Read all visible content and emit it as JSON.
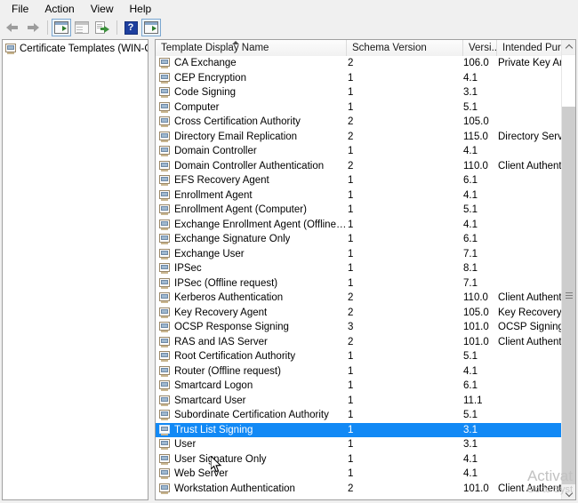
{
  "menu": {
    "items": [
      {
        "label": "File"
      },
      {
        "label": "Action"
      },
      {
        "label": "View"
      },
      {
        "label": "Help"
      }
    ]
  },
  "toolbar": {
    "back": {
      "name": "back-arrow-icon",
      "label": "Back"
    },
    "forward": {
      "name": "forward-arrow-icon",
      "label": "Forward"
    },
    "show_hide_tree": {
      "name": "show-hide-console-tree-icon",
      "label": "Show/Hide Console Tree"
    },
    "properties": {
      "name": "properties-icon",
      "label": "Properties"
    },
    "export_list": {
      "name": "export-list-icon",
      "label": "Export List"
    },
    "help": {
      "name": "help-icon",
      "label": "Help",
      "glyph": "?"
    },
    "show_action_pane": {
      "name": "show-hide-action-pane-icon",
      "label": "Show/Hide Action Pane"
    }
  },
  "tree": {
    "items": [
      {
        "label": "Certificate Templates (WIN-ODE",
        "icon": "certificate-templates-icon"
      }
    ]
  },
  "list": {
    "columns": [
      {
        "label": "Template Display Name",
        "sorted": "asc"
      },
      {
        "label": "Schema Version"
      },
      {
        "label": "Versi..."
      },
      {
        "label": "Intended Purp"
      }
    ],
    "selected_index": 25,
    "rows": [
      {
        "name": "CA Exchange",
        "schema": "2",
        "version": "106.0",
        "purpose": "Private Key Arc"
      },
      {
        "name": "CEP Encryption",
        "schema": "1",
        "version": "4.1",
        "purpose": ""
      },
      {
        "name": "Code Signing",
        "schema": "1",
        "version": "3.1",
        "purpose": ""
      },
      {
        "name": "Computer",
        "schema": "1",
        "version": "5.1",
        "purpose": ""
      },
      {
        "name": "Cross Certification Authority",
        "schema": "2",
        "version": "105.0",
        "purpose": ""
      },
      {
        "name": "Directory Email Replication",
        "schema": "2",
        "version": "115.0",
        "purpose": "Directory Servi"
      },
      {
        "name": "Domain Controller",
        "schema": "1",
        "version": "4.1",
        "purpose": ""
      },
      {
        "name": "Domain Controller Authentication",
        "schema": "2",
        "version": "110.0",
        "purpose": "Client Authent"
      },
      {
        "name": "EFS Recovery Agent",
        "schema": "1",
        "version": "6.1",
        "purpose": ""
      },
      {
        "name": "Enrollment Agent",
        "schema": "1",
        "version": "4.1",
        "purpose": ""
      },
      {
        "name": "Enrollment Agent (Computer)",
        "schema": "1",
        "version": "5.1",
        "purpose": ""
      },
      {
        "name": "Exchange Enrollment Agent (Offline requ...",
        "schema": "1",
        "version": "4.1",
        "purpose": ""
      },
      {
        "name": "Exchange Signature Only",
        "schema": "1",
        "version": "6.1",
        "purpose": ""
      },
      {
        "name": "Exchange User",
        "schema": "1",
        "version": "7.1",
        "purpose": ""
      },
      {
        "name": "IPSec",
        "schema": "1",
        "version": "8.1",
        "purpose": ""
      },
      {
        "name": "IPSec (Offline request)",
        "schema": "1",
        "version": "7.1",
        "purpose": ""
      },
      {
        "name": "Kerberos Authentication",
        "schema": "2",
        "version": "110.0",
        "purpose": "Client Authent"
      },
      {
        "name": "Key Recovery Agent",
        "schema": "2",
        "version": "105.0",
        "purpose": "Key Recovery A"
      },
      {
        "name": "OCSP Response Signing",
        "schema": "3",
        "version": "101.0",
        "purpose": "OCSP Signing"
      },
      {
        "name": "RAS and IAS Server",
        "schema": "2",
        "version": "101.0",
        "purpose": "Client Authent"
      },
      {
        "name": "Root Certification Authority",
        "schema": "1",
        "version": "5.1",
        "purpose": ""
      },
      {
        "name": "Router (Offline request)",
        "schema": "1",
        "version": "4.1",
        "purpose": ""
      },
      {
        "name": "Smartcard Logon",
        "schema": "1",
        "version": "6.1",
        "purpose": ""
      },
      {
        "name": "Smartcard User",
        "schema": "1",
        "version": "11.1",
        "purpose": ""
      },
      {
        "name": "Subordinate Certification Authority",
        "schema": "1",
        "version": "5.1",
        "purpose": ""
      },
      {
        "name": "Trust List Signing",
        "schema": "1",
        "version": "3.1",
        "purpose": ""
      },
      {
        "name": "User",
        "schema": "1",
        "version": "3.1",
        "purpose": ""
      },
      {
        "name": "User Signature Only",
        "schema": "1",
        "version": "4.1",
        "purpose": ""
      },
      {
        "name": "Web Server",
        "schema": "1",
        "version": "4.1",
        "purpose": ""
      },
      {
        "name": "Workstation Authentication",
        "schema": "2",
        "version": "101.0",
        "purpose": "Client Authent"
      }
    ]
  },
  "scrollbar": {
    "up_arrow": "∧",
    "down_arrow": "∨",
    "thumb_top_pct": 12,
    "thumb_height_pct": 88
  },
  "watermark": {
    "line1": "Activat",
    "line2": "Go to Syst"
  },
  "colors": {
    "selection": "#1289f5",
    "window": "#f0f0f0",
    "list_bg": "#ffffff",
    "header_text": "#1a1a1a"
  }
}
